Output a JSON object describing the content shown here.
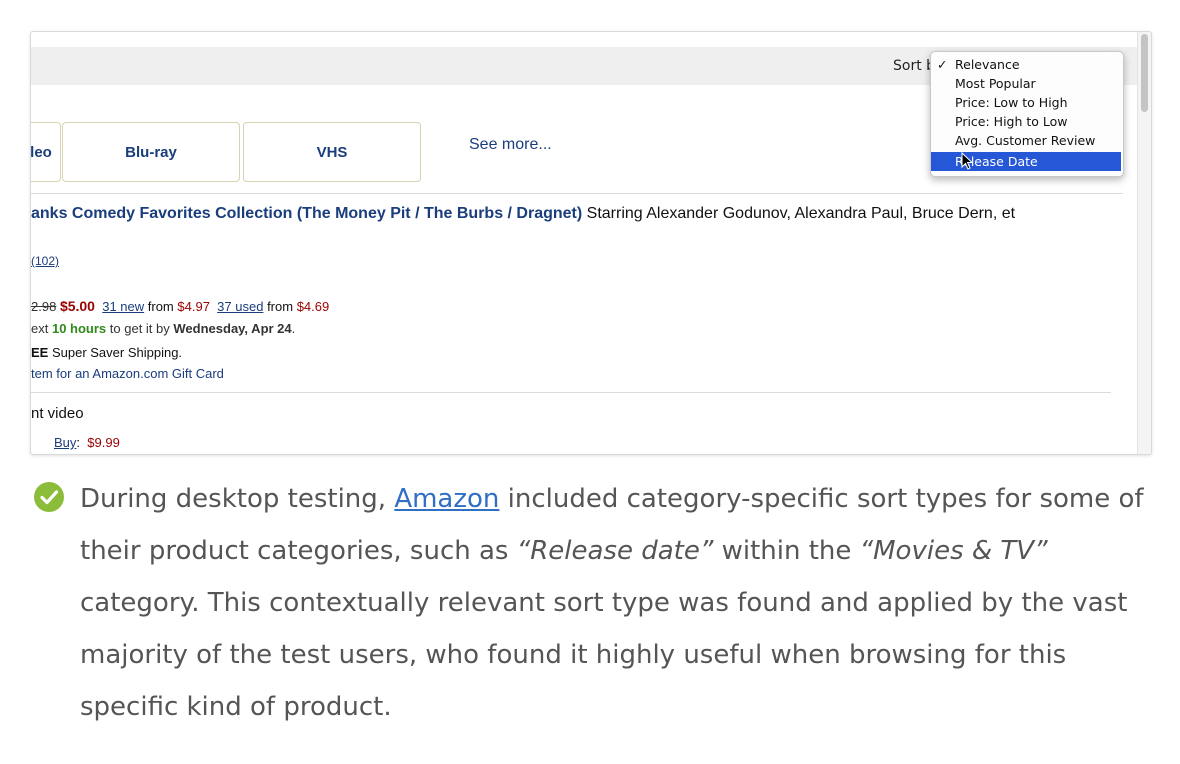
{
  "sort": {
    "label": "Sort b",
    "options": [
      "Relevance",
      "Most Popular",
      "Price: Low to High",
      "Price: High to Low",
      "Avg. Customer Review",
      "Release Date"
    ],
    "checked_index": 0,
    "highlighted_index": 5,
    "check_mark": "✓"
  },
  "formats": {
    "partial": "leo",
    "bluray": "Blu-ray",
    "vhs": "VHS",
    "see_more": "See more..."
  },
  "product": {
    "title": "anks Comedy Favorites Collection (The Money Pit / The Burbs / Dragnet)",
    "starring": " Starring Alexander Godunov, Alexandra Paul, Bruce Dern, et",
    "reviews_count": "(102)",
    "list_price": "2.98",
    "price": "$5.00",
    "new_offers": "31 new",
    "new_from_label": "from",
    "new_from": "$4.97",
    "used_offers": "37 used",
    "used_from_label": "from",
    "used_from": "$4.69",
    "ship_prefix": "ext",
    "ship_hours": "10 hours",
    "ship_mid": "to get it by",
    "ship_date": "Wednesday, Apr 24",
    "ship_end": ".",
    "free_bold": "EE",
    "free_text": " Super Saver Shipping.",
    "gift": "tem for an Amazon.com Gift Card",
    "instant_video": "nt video",
    "buy_label": "Buy",
    "buy_colon": ":",
    "buy_price": "$9.99"
  },
  "note": {
    "p1": "During desktop testing, ",
    "link": "Amazon",
    "p2": " included category-specific sort types for some of their product categories, such as ",
    "em1": "“Release date”",
    "p3": " within the ",
    "em2": "“Movies & TV”",
    "p4": " category. This contextually relevant sort type was found and applied by the vast majority of the test users, who found it highly useful when browsing for this specific kind of product."
  },
  "colors": {
    "link_blue": "#1a3d7c",
    "price_red": "#990000",
    "ship_green": "#2f8a1a",
    "highlight": "#2557d6",
    "check_green": "#8bbd3a",
    "article_link": "#2f6fc4"
  }
}
